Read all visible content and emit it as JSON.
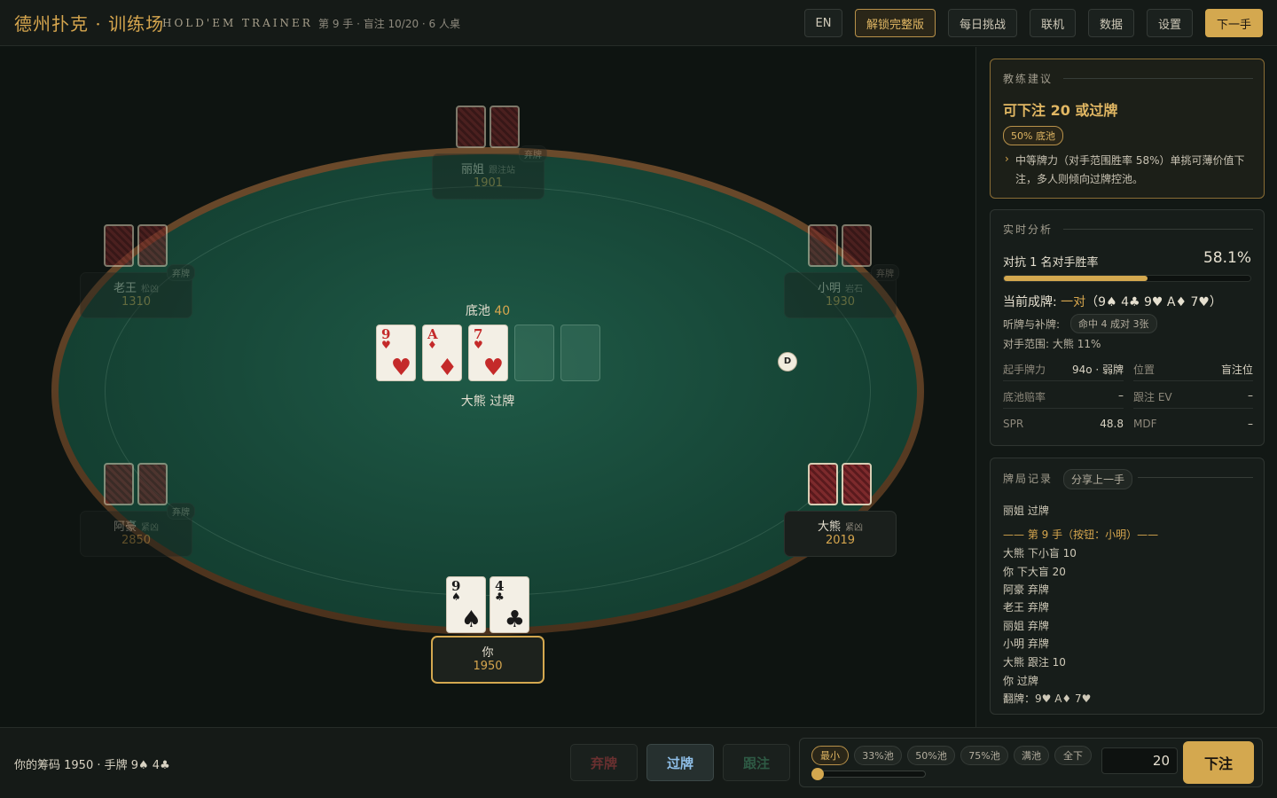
{
  "header": {
    "title": "德州扑克 · 训练场",
    "subtitle": "HOLD'EM TRAINER",
    "hand_info": "第 9 手 · 盲注 10/20 · 6 人桌",
    "buttons": {
      "lang": "EN",
      "unlock": "解锁完整版",
      "daily": "每日挑战",
      "online": "联机",
      "stats": "数据",
      "settings": "设置",
      "next_hand": "下一手"
    }
  },
  "table": {
    "pot_label": "底池",
    "pot_amount": "40",
    "last_action": "大熊 过牌",
    "dealer_button": "D",
    "board": [
      {
        "rank": "9",
        "suit": "♥",
        "color": "red"
      },
      {
        "rank": "A",
        "suit": "♦",
        "color": "red"
      },
      {
        "rank": "7",
        "suit": "♥",
        "color": "red"
      }
    ],
    "hero_cards": [
      {
        "rank": "9",
        "suit": "♠",
        "color": "black"
      },
      {
        "rank": "4",
        "suit": "♣",
        "color": "black"
      }
    ],
    "seats": {
      "lijie": {
        "name": "丽姐",
        "style": "跟注站",
        "chips": "1901",
        "status": "弃牌"
      },
      "laowang": {
        "name": "老王",
        "style": "松凶",
        "chips": "1310",
        "status": "弃牌"
      },
      "xiaoming": {
        "name": "小明",
        "style": "岩石",
        "chips": "1930",
        "status": "弃牌"
      },
      "ahao": {
        "name": "阿豪",
        "style": "紧凶",
        "chips": "2850",
        "status": "弃牌"
      },
      "daxiong": {
        "name": "大熊",
        "style": "紧凶",
        "chips": "2019"
      },
      "hero": {
        "name": "你",
        "chips": "1950"
      }
    }
  },
  "coach": {
    "title": "教练建议",
    "headline": "可下注 20 或过牌",
    "badge": "50% 底池",
    "bullet": "›",
    "advice": "中等牌力（对手范围胜率 58%）单挑可薄价值下注，多人则倾向过牌控池。"
  },
  "analysis": {
    "title": "实时分析",
    "equity_label": "对抗 1 名对手胜率",
    "equity_value": "58.1%",
    "equity_fraction": 0.581,
    "made_hand_label": "当前成牌:",
    "made_hand_value": "一对",
    "made_hand_cards": "（9♠ 4♣ 9♥ A♦ 7♥）",
    "draws_label": "听牌与补牌:",
    "draws_badge": "命中 4 成对 3张",
    "range_label": "对手范围:",
    "range_value": "大熊 11%",
    "stats": {
      "start_hand_label": "起手牌力",
      "start_hand_value": "94o · 弱牌",
      "position_label": "位置",
      "position_value": "盲注位",
      "pot_odds_label": "底池赔率",
      "pot_odds_value": "–",
      "call_ev_label": "跟注 EV",
      "call_ev_value": "–",
      "spr_label": "SPR",
      "spr_value": "48.8",
      "mdf_label": "MDF",
      "mdf_value": "–"
    }
  },
  "log": {
    "title": "牌局记录",
    "share_button": "分享上一手",
    "lines_before": [
      "丽姐 过牌"
    ],
    "hand_header": "—— 第 9 手（按钮：小明）——",
    "lines": [
      "大熊 下小盲 10",
      "你 下大盲 20",
      "阿豪 弃牌",
      "老王 弃牌",
      "丽姐 弃牌",
      "小明 弃牌",
      "大熊 跟注 10",
      "你 过牌",
      "翻牌：9♥ A♦ 7♥"
    ]
  },
  "bottom": {
    "stack_info": "你的筹码 1950 · 手牌 9♠ 4♣",
    "fold": "弃牌",
    "check": "过牌",
    "call": "跟注",
    "presets": [
      "最小",
      "33%池",
      "50%池",
      "75%池",
      "满池",
      "全下"
    ],
    "bet_amount": "20",
    "bet_button": "下注",
    "slider_fraction": 0.0
  },
  "colors": {
    "accent": "#d4a84f",
    "felt": "#1f5a47",
    "card_red": "#c42a2a"
  }
}
